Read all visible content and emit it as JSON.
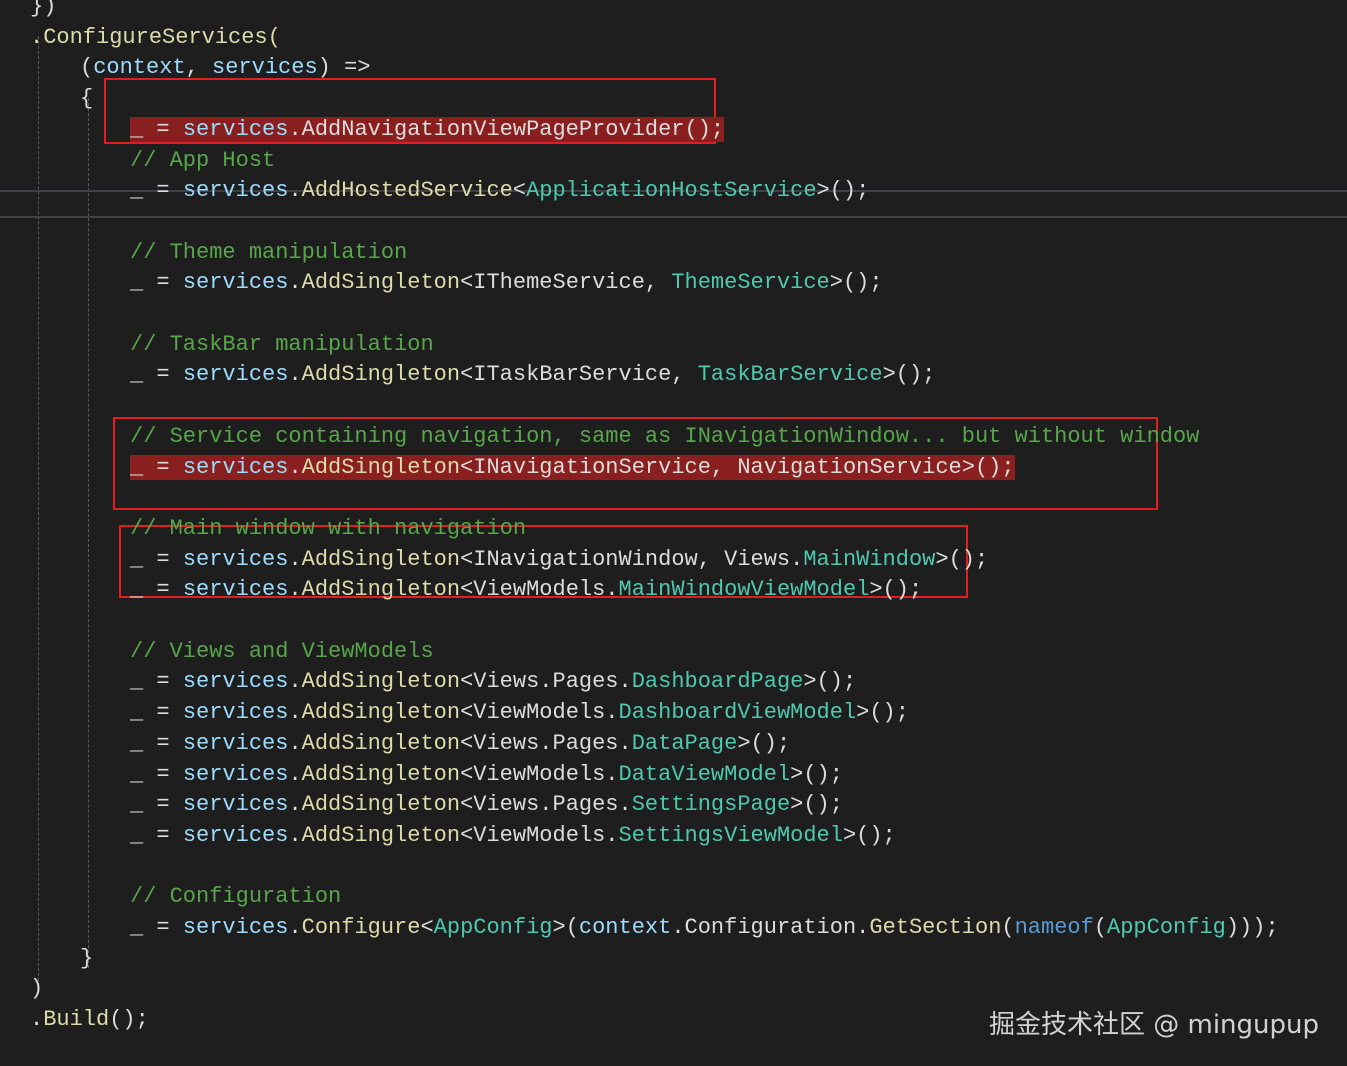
{
  "code_lines": [
    {
      "indent": 0,
      "tokens": [
        {
          "t": "})",
          "c": "t"
        }
      ]
    },
    {
      "indent": 0,
      "tokens": [
        {
          "t": ".ConfigureServices(",
          "c": "m"
        }
      ]
    },
    {
      "indent": 1,
      "tokens": [
        {
          "t": "(",
          "c": "t"
        },
        {
          "t": "context",
          "c": "v"
        },
        {
          "t": ", ",
          "c": "t"
        },
        {
          "t": "services",
          "c": "v"
        },
        {
          "t": ") =>",
          "c": "t"
        }
      ]
    },
    {
      "indent": 1,
      "tokens": [
        {
          "t": "{",
          "c": "t"
        }
      ]
    },
    {
      "indent": 2,
      "highlight": true,
      "tokens": [
        {
          "t": "_ = ",
          "c": "t"
        },
        {
          "t": "services",
          "c": "v"
        },
        {
          "t": ".AddNavigationViewPageProvider();",
          "c": "t"
        }
      ]
    },
    {
      "indent": 2,
      "tokens": [
        {
          "t": "// App Host",
          "c": "c"
        }
      ]
    },
    {
      "indent": 2,
      "tokens": [
        {
          "t": "_ = ",
          "c": "t"
        },
        {
          "t": "services",
          "c": "v"
        },
        {
          "t": ".",
          "c": "t"
        },
        {
          "t": "AddHostedService",
          "c": "m"
        },
        {
          "t": "<",
          "c": "t"
        },
        {
          "t": "ApplicationHostService",
          "c": "ty"
        },
        {
          "t": ">();",
          "c": "t"
        }
      ]
    },
    {
      "indent": 2,
      "tokens": []
    },
    {
      "indent": 2,
      "tokens": [
        {
          "t": "// Theme manipulation",
          "c": "c"
        }
      ]
    },
    {
      "indent": 2,
      "tokens": [
        {
          "t": "_ = ",
          "c": "t"
        },
        {
          "t": "services",
          "c": "v"
        },
        {
          "t": ".",
          "c": "t"
        },
        {
          "t": "AddSingleton",
          "c": "m"
        },
        {
          "t": "<IThemeService, ",
          "c": "t"
        },
        {
          "t": "ThemeService",
          "c": "ty"
        },
        {
          "t": ">();",
          "c": "t"
        }
      ]
    },
    {
      "indent": 2,
      "tokens": []
    },
    {
      "indent": 2,
      "tokens": [
        {
          "t": "// TaskBar manipulation",
          "c": "c"
        }
      ]
    },
    {
      "indent": 2,
      "tokens": [
        {
          "t": "_ = ",
          "c": "t"
        },
        {
          "t": "services",
          "c": "v"
        },
        {
          "t": ".",
          "c": "t"
        },
        {
          "t": "AddSingleton",
          "c": "m"
        },
        {
          "t": "<ITaskBarService, ",
          "c": "t"
        },
        {
          "t": "TaskBarService",
          "c": "ty"
        },
        {
          "t": ">();",
          "c": "t"
        }
      ]
    },
    {
      "indent": 2,
      "tokens": []
    },
    {
      "indent": 2,
      "tokens": [
        {
          "t": "// Service containing navigation, same as INavigationWindow... but without window",
          "c": "c"
        }
      ]
    },
    {
      "indent": 2,
      "highlight": true,
      "tokens": [
        {
          "t": "_ = ",
          "c": "t"
        },
        {
          "t": "services",
          "c": "v"
        },
        {
          "t": ".",
          "c": "t"
        },
        {
          "t": "AddSingleton",
          "c": "m"
        },
        {
          "t": "<INavigationService, NavigationService>();",
          "c": "t"
        }
      ]
    },
    {
      "indent": 2,
      "tokens": []
    },
    {
      "indent": 2,
      "tokens": [
        {
          "t": "// Main window with navigation",
          "c": "c"
        }
      ]
    },
    {
      "indent": 2,
      "tokens": [
        {
          "t": "_ = ",
          "c": "t"
        },
        {
          "t": "services",
          "c": "v"
        },
        {
          "t": ".",
          "c": "t"
        },
        {
          "t": "AddSingleton",
          "c": "m"
        },
        {
          "t": "<INavigationWindow, Views.",
          "c": "t"
        },
        {
          "t": "MainWindow",
          "c": "ty"
        },
        {
          "t": ">();",
          "c": "t"
        }
      ]
    },
    {
      "indent": 2,
      "tokens": [
        {
          "t": "_ = ",
          "c": "t"
        },
        {
          "t": "services",
          "c": "v"
        },
        {
          "t": ".",
          "c": "t"
        },
        {
          "t": "AddSingleton",
          "c": "m"
        },
        {
          "t": "<ViewModels.",
          "c": "t"
        },
        {
          "t": "MainWindowViewModel",
          "c": "ty"
        },
        {
          "t": ">();",
          "c": "t"
        }
      ]
    },
    {
      "indent": 2,
      "tokens": []
    },
    {
      "indent": 2,
      "tokens": [
        {
          "t": "// Views and ViewModels",
          "c": "c"
        }
      ]
    },
    {
      "indent": 2,
      "tokens": [
        {
          "t": "_ = ",
          "c": "t"
        },
        {
          "t": "services",
          "c": "v"
        },
        {
          "t": ".",
          "c": "t"
        },
        {
          "t": "AddSingleton",
          "c": "m"
        },
        {
          "t": "<Views.Pages.",
          "c": "t"
        },
        {
          "t": "DashboardPage",
          "c": "ty"
        },
        {
          "t": ">();",
          "c": "t"
        }
      ]
    },
    {
      "indent": 2,
      "tokens": [
        {
          "t": "_ = ",
          "c": "t"
        },
        {
          "t": "services",
          "c": "v"
        },
        {
          "t": ".",
          "c": "t"
        },
        {
          "t": "AddSingleton",
          "c": "m"
        },
        {
          "t": "<ViewModels.",
          "c": "t"
        },
        {
          "t": "DashboardViewModel",
          "c": "ty"
        },
        {
          "t": ">();",
          "c": "t"
        }
      ]
    },
    {
      "indent": 2,
      "tokens": [
        {
          "t": "_ = ",
          "c": "t"
        },
        {
          "t": "services",
          "c": "v"
        },
        {
          "t": ".",
          "c": "t"
        },
        {
          "t": "AddSingleton",
          "c": "m"
        },
        {
          "t": "<Views.Pages.",
          "c": "t"
        },
        {
          "t": "DataPage",
          "c": "ty"
        },
        {
          "t": ">();",
          "c": "t"
        }
      ]
    },
    {
      "indent": 2,
      "tokens": [
        {
          "t": "_ = ",
          "c": "t"
        },
        {
          "t": "services",
          "c": "v"
        },
        {
          "t": ".",
          "c": "t"
        },
        {
          "t": "AddSingleton",
          "c": "m"
        },
        {
          "t": "<ViewModels.",
          "c": "t"
        },
        {
          "t": "DataViewModel",
          "c": "ty"
        },
        {
          "t": ">();",
          "c": "t"
        }
      ]
    },
    {
      "indent": 2,
      "tokens": [
        {
          "t": "_ = ",
          "c": "t"
        },
        {
          "t": "services",
          "c": "v"
        },
        {
          "t": ".",
          "c": "t"
        },
        {
          "t": "AddSingleton",
          "c": "m"
        },
        {
          "t": "<Views.Pages.",
          "c": "t"
        },
        {
          "t": "SettingsPage",
          "c": "ty"
        },
        {
          "t": ">();",
          "c": "t"
        }
      ]
    },
    {
      "indent": 2,
      "tokens": [
        {
          "t": "_ = ",
          "c": "t"
        },
        {
          "t": "services",
          "c": "v"
        },
        {
          "t": ".",
          "c": "t"
        },
        {
          "t": "AddSingleton",
          "c": "m"
        },
        {
          "t": "<ViewModels.",
          "c": "t"
        },
        {
          "t": "SettingsViewModel",
          "c": "ty"
        },
        {
          "t": ">();",
          "c": "t"
        }
      ]
    },
    {
      "indent": 2,
      "tokens": []
    },
    {
      "indent": 2,
      "tokens": [
        {
          "t": "// Configuration",
          "c": "c"
        }
      ]
    },
    {
      "indent": 2,
      "tokens": [
        {
          "t": "_ = ",
          "c": "t"
        },
        {
          "t": "services",
          "c": "v"
        },
        {
          "t": ".",
          "c": "t"
        },
        {
          "t": "Configure",
          "c": "m"
        },
        {
          "t": "<",
          "c": "t"
        },
        {
          "t": "AppConfig",
          "c": "ty"
        },
        {
          "t": ">(",
          "c": "t"
        },
        {
          "t": "context",
          "c": "v"
        },
        {
          "t": ".Configuration.",
          "c": "t"
        },
        {
          "t": "GetSection",
          "c": "m"
        },
        {
          "t": "(",
          "c": "t"
        },
        {
          "t": "nameof",
          "c": "k"
        },
        {
          "t": "(",
          "c": "t"
        },
        {
          "t": "AppConfig",
          "c": "ty"
        },
        {
          "t": ")));",
          "c": "t"
        }
      ]
    },
    {
      "indent": 1,
      "tokens": [
        {
          "t": "}",
          "c": "t"
        }
      ]
    },
    {
      "indent": 0,
      "tokens": [
        {
          "t": ")",
          "c": "t"
        }
      ]
    },
    {
      "indent": 0,
      "tokens": [
        {
          "t": ".",
          "c": "t"
        },
        {
          "t": "Build",
          "c": "m"
        },
        {
          "t": "();",
          "c": "t"
        }
      ]
    }
  ],
  "colors": {
    "background": "#1e1e1e",
    "text": "#dcdcdc",
    "variable": "#9cdcfe",
    "method": "#dcdcaa",
    "comment": "#57a64a",
    "type": "#4ec9b0",
    "keyword": "#569cd6",
    "highlight": "#8a1f1f",
    "annotation_box": "#e02020"
  },
  "watermark": "掘金技术社区 @ mingupup"
}
